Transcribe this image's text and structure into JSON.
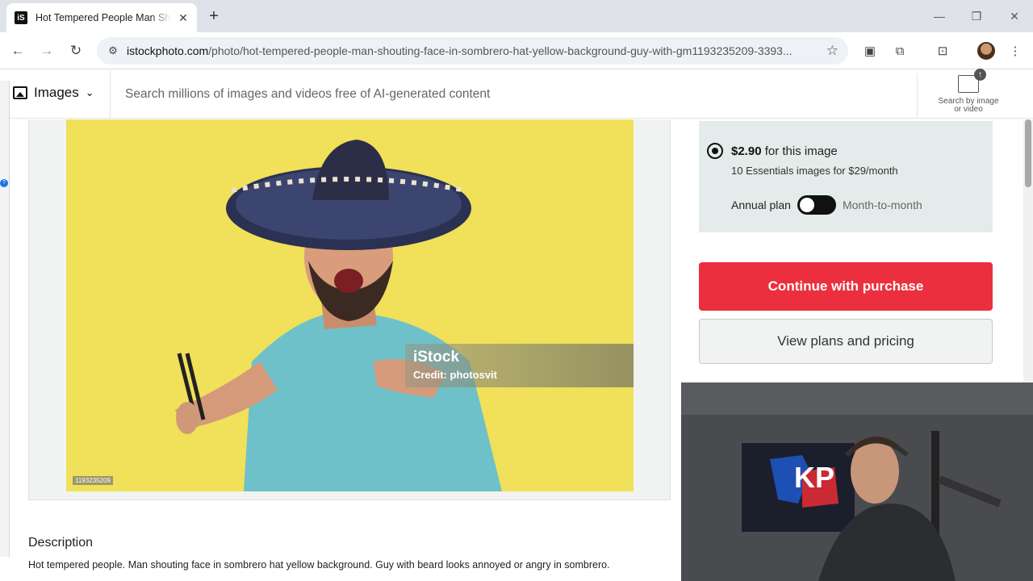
{
  "browser": {
    "tab_title": "Hot Tempered People Man Shouting Face in Sombrero",
    "tab_favicon_text": "iS",
    "url_host": "istockphoto.com",
    "url_path": "/photo/hot-tempered-people-man-shouting-face-in-sombrero-hat-yellow-background-guy-with-gm1193235209-3393..."
  },
  "header": {
    "images_dropdown_label": "Images",
    "search_placeholder": "Search millions of images and videos free of AI-generated content",
    "search_by_image_line1": "Search by image",
    "search_by_image_line2": "or video"
  },
  "photo": {
    "watermark_brand": "iStock",
    "watermark_credit": "Credit: photosvit",
    "photo_id": "1193235209"
  },
  "description": {
    "title": "Description",
    "text": "Hot tempered people. Man shouting face in sombrero hat yellow background. Guy with beard looks annoyed or angry in sombrero."
  },
  "purchase": {
    "price": "$2.90",
    "price_suffix": "for this image",
    "subscription_line": "10 Essentials images for $29/month",
    "annual_plan_label": "Annual plan",
    "monthly_label": "Month-to-month",
    "continue_button": "Continue with purchase",
    "plans_button": "View plans and pricing"
  },
  "colors": {
    "primary_button": "#ec2f3e",
    "price_box_bg": "#e3ecea",
    "photo_bg": "#f0e05a"
  }
}
